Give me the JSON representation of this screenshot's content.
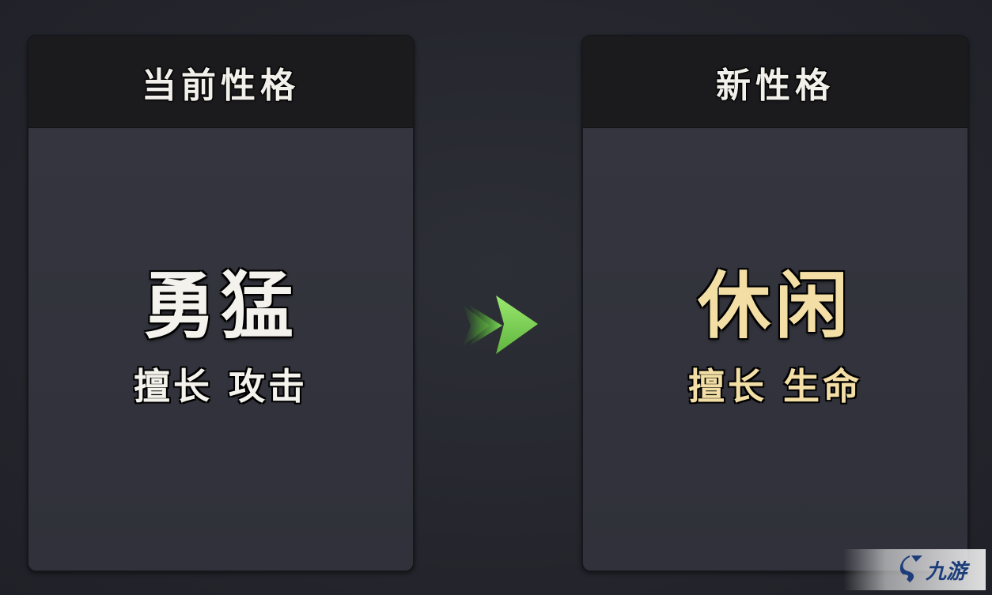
{
  "current_card": {
    "header": "当前性格",
    "trait_name": "勇猛",
    "trait_desc": "擅长 攻击"
  },
  "new_card": {
    "header": "新性格",
    "trait_name": "休闲",
    "trait_desc": "擅长 生命"
  },
  "arrow": {
    "icon": "double-arrow-right-icon",
    "color": "#7ed957"
  },
  "watermark": {
    "text": "九游",
    "color": "#1d3d7a"
  },
  "colors": {
    "current_trait": "#f4f2ec",
    "new_trait": "#f3dfa6",
    "card_header_bg": "#1b1b1e",
    "card_body_bg": "#32333c"
  }
}
